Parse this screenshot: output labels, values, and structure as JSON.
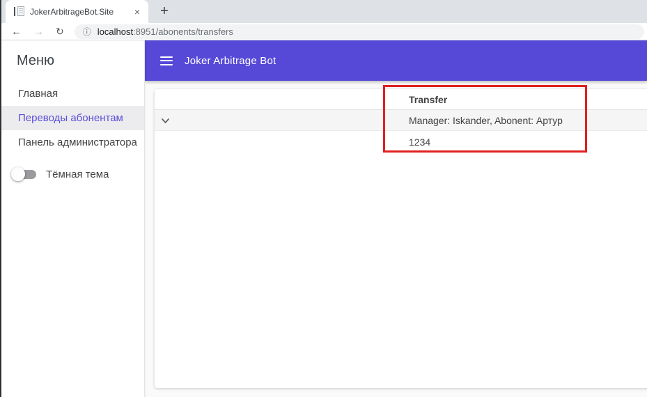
{
  "browser": {
    "tab_title": "JokerArbitrageBot.Site",
    "close_tab_glyph": "×",
    "new_tab_glyph": "+",
    "back_glyph": "←",
    "forward_glyph": "→",
    "reload_glyph": "↻",
    "info_glyph": "ⓘ",
    "url_host": "localhost",
    "url_rest": ":8951/abonents/transfers"
  },
  "sidebar": {
    "title": "Меню",
    "items": [
      {
        "label": "Главная",
        "selected": false
      },
      {
        "label": "Переводы абонентам",
        "selected": true
      },
      {
        "label": "Панель администратора",
        "selected": false
      }
    ],
    "theme_toggle": {
      "label": "Тёмная тема",
      "state": "off"
    }
  },
  "appbar": {
    "title": "Joker Arbitrage Bot"
  },
  "transfers_table": {
    "header": "Transfer",
    "rows": [
      {
        "summary": "Manager: Iskander, Abonent: Артур",
        "detail": "1234",
        "expanded": true
      }
    ]
  },
  "annotation": {
    "shape": "rectangle",
    "color": "#e01f1f"
  },
  "colors": {
    "appbar_purple": "#5649d8",
    "selected_link_purple": "#5a4fd8",
    "selected_item_bg": "#ececee",
    "row_stripe_gray": "#f5f5f6",
    "annotation_red": "#e01f1f"
  }
}
